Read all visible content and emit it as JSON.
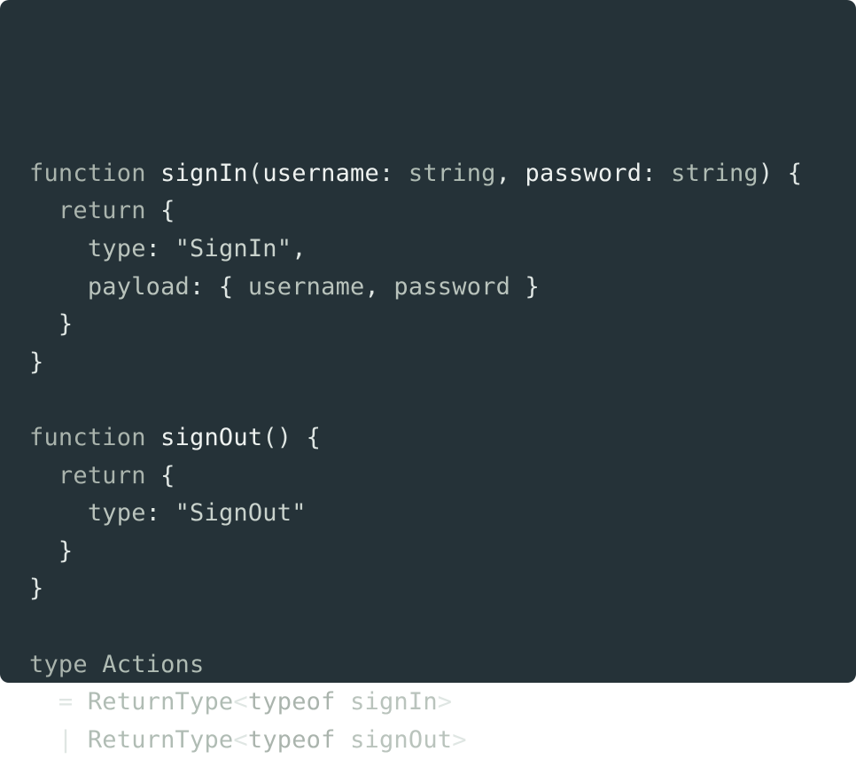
{
  "colors": {
    "background": "#253238",
    "text": "#dfe6e3",
    "keyword": "#aab4ad",
    "identifier": "#eef2f0"
  },
  "code_lines": [
    [
      {
        "t": "function ",
        "k": "keyword"
      },
      {
        "t": "signIn",
        "k": "name"
      },
      {
        "t": "(",
        "k": "punct"
      },
      {
        "t": "username",
        "k": "name"
      },
      {
        "t": ": ",
        "k": "punct"
      },
      {
        "t": "string",
        "k": "type"
      },
      {
        "t": ", ",
        "k": "punct"
      },
      {
        "t": "password",
        "k": "name"
      },
      {
        "t": ": ",
        "k": "punct"
      },
      {
        "t": "string",
        "k": "type"
      },
      {
        "t": ") {",
        "k": "punct"
      }
    ],
    [
      {
        "t": "  return ",
        "k": "keyword"
      },
      {
        "t": "{",
        "k": "punct"
      }
    ],
    [
      {
        "t": "    type",
        "k": "prop"
      },
      {
        "t": ": ",
        "k": "punct"
      },
      {
        "t": "\"SignIn\"",
        "k": "string"
      },
      {
        "t": ",",
        "k": "punct"
      }
    ],
    [
      {
        "t": "    payload",
        "k": "prop"
      },
      {
        "t": ": { ",
        "k": "punct"
      },
      {
        "t": "username",
        "k": "ref"
      },
      {
        "t": ", ",
        "k": "punct"
      },
      {
        "t": "password",
        "k": "ref"
      },
      {
        "t": " }",
        "k": "punct"
      }
    ],
    [
      {
        "t": "  }",
        "k": "punct"
      }
    ],
    [
      {
        "t": "}",
        "k": "punct"
      }
    ],
    [],
    [
      {
        "t": "function ",
        "k": "keyword"
      },
      {
        "t": "signOut",
        "k": "name"
      },
      {
        "t": "() {",
        "k": "punct"
      }
    ],
    [
      {
        "t": "  return ",
        "k": "keyword"
      },
      {
        "t": "{",
        "k": "punct"
      }
    ],
    [
      {
        "t": "    type",
        "k": "prop"
      },
      {
        "t": ": ",
        "k": "punct"
      },
      {
        "t": "\"SignOut\"",
        "k": "string"
      }
    ],
    [
      {
        "t": "  }",
        "k": "punct"
      }
    ],
    [
      {
        "t": "}",
        "k": "punct"
      }
    ],
    [],
    [
      {
        "t": "type ",
        "k": "keyword"
      },
      {
        "t": "Actions",
        "k": "type"
      }
    ],
    [
      {
        "t": "  = ",
        "k": "punct"
      },
      {
        "t": "ReturnType",
        "k": "type"
      },
      {
        "t": "<",
        "k": "angle"
      },
      {
        "t": "typeof ",
        "k": "keyword"
      },
      {
        "t": "signIn",
        "k": "ref"
      },
      {
        "t": ">",
        "k": "angle"
      }
    ],
    [
      {
        "t": "  | ",
        "k": "punct"
      },
      {
        "t": "ReturnType",
        "k": "type"
      },
      {
        "t": "<",
        "k": "angle"
      },
      {
        "t": "typeof ",
        "k": "keyword"
      },
      {
        "t": "signOut",
        "k": "ref"
      },
      {
        "t": ">",
        "k": "angle"
      }
    ]
  ]
}
